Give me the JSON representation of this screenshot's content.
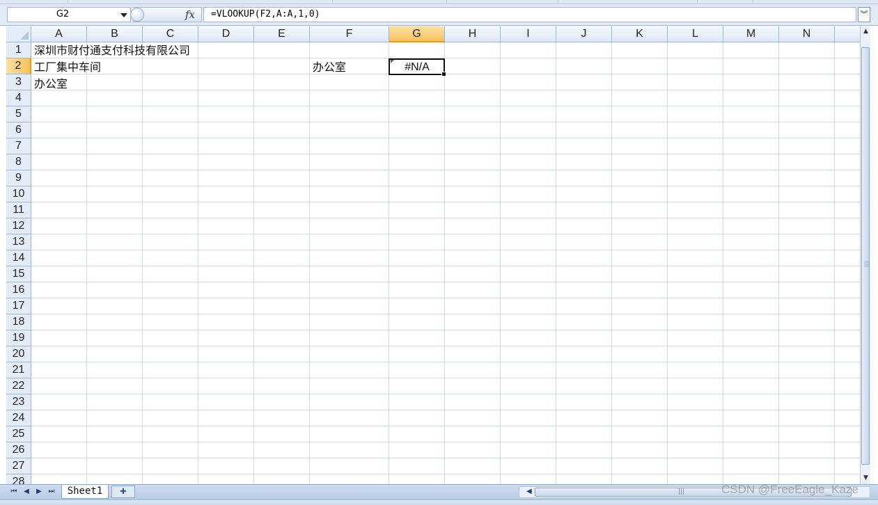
{
  "formula_bar": {
    "name_box": "G2",
    "fx_label": "fx",
    "formula": "=VLOOKUP(F2,A:A,1,0)",
    "expand_glyph": "︾"
  },
  "columns": [
    "A",
    "B",
    "C",
    "D",
    "E",
    "F",
    "G",
    "H",
    "I",
    "J",
    "K",
    "L",
    "M",
    "N"
  ],
  "active_column": "G",
  "rows": [
    "1",
    "2",
    "3",
    "4",
    "5",
    "6",
    "7",
    "8",
    "9",
    "10",
    "11",
    "12",
    "13",
    "14",
    "15",
    "16",
    "17",
    "18",
    "19",
    "20",
    "21",
    "22",
    "23",
    "24",
    "25",
    "26",
    "27",
    "28"
  ],
  "active_row": "2",
  "cells": {
    "A1": "深圳市财付通支付科技有限公司",
    "A2": "工厂集中车间",
    "A3": "办公室",
    "F2": "办公室",
    "G2": "#N/A"
  },
  "sheet_tabs": {
    "active": "Sheet1"
  },
  "watermark": "CSDN @FreeEagle_Kaze",
  "colors": {
    "grid_line": "#d0d7e5",
    "header_bg": "#e4ecf7",
    "active_header": "#f7c25d",
    "error_indicator": "#3a7a3a"
  },
  "icons": [
    "fx-icon",
    "dropdown-arrow-icon",
    "scroll-up-icon",
    "scroll-down-icon",
    "first-sheet-icon",
    "prev-sheet-icon",
    "next-sheet-icon",
    "last-sheet-icon",
    "new-sheet-icon",
    "scroll-left-icon"
  ]
}
